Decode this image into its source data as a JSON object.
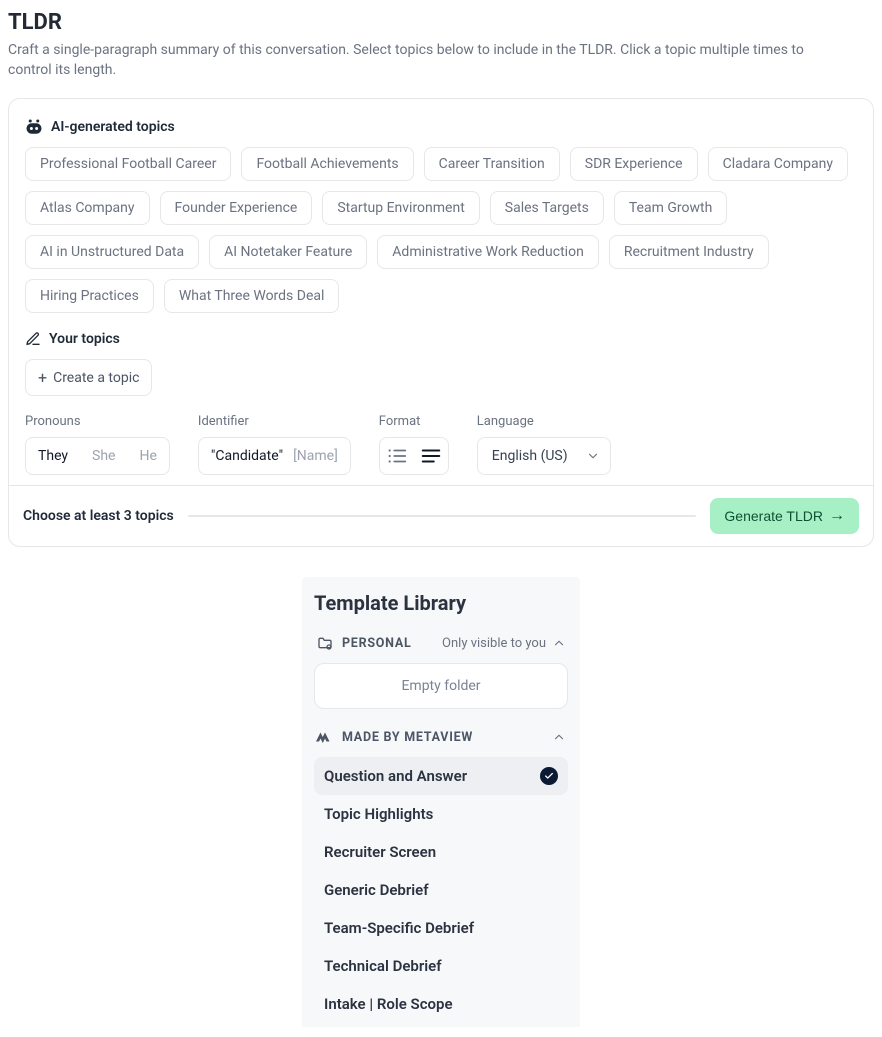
{
  "header": {
    "title": "TLDR",
    "subtitle": "Craft a single-paragraph summary of this conversation. Select topics below to include in the TLDR. Click a topic multiple times to control its length."
  },
  "ai_topics": {
    "label": "AI-generated topics",
    "items": [
      "Professional Football Career",
      "Football Achievements",
      "Career Transition",
      "SDR Experience",
      "Cladara Company",
      "Atlas Company",
      "Founder Experience",
      "Startup Environment",
      "Sales Targets",
      "Team Growth",
      "AI in Unstructured Data",
      "AI Notetaker Feature",
      "Administrative Work Reduction",
      "Recruitment Industry",
      "Hiring Practices",
      "What Three Words Deal"
    ]
  },
  "your_topics": {
    "label": "Your topics",
    "create_label": "Create a topic"
  },
  "controls": {
    "pronouns": {
      "label": "Pronouns",
      "options": [
        "They",
        "She",
        "He"
      ],
      "selected": "They"
    },
    "identifier": {
      "label": "Identifier",
      "candidate": "\"Candidate\"",
      "name": "[Name]"
    },
    "format": {
      "label": "Format"
    },
    "language": {
      "label": "Language",
      "selected": "English (US)"
    }
  },
  "footer": {
    "hint": "Choose at least 3 topics",
    "generate_label": "Generate TLDR"
  },
  "library": {
    "title": "Template Library",
    "personal": {
      "label": "PERSONAL",
      "visibility": "Only visible to you",
      "empty": "Empty folder"
    },
    "metaview": {
      "label": "MADE BY METAVIEW",
      "items": [
        "Question and Answer",
        "Topic Highlights",
        "Recruiter Screen",
        "Generic Debrief",
        "Team-Specific Debrief",
        "Technical Debrief",
        "Intake | Role Scope"
      ],
      "selected_index": 0
    }
  }
}
